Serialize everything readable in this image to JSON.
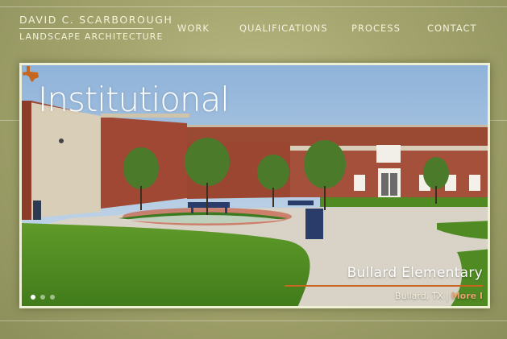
{
  "brand": {
    "name": "DAVID C. SCARBOROUGH",
    "tagline": "LANDSCAPE ARCHITECTURE"
  },
  "nav": {
    "items": [
      {
        "label": "WORK"
      },
      {
        "label": "QUALIFICATIONS"
      },
      {
        "label": "PROCESS"
      },
      {
        "label": "CONTACT"
      }
    ]
  },
  "hero": {
    "category": "Institutional",
    "category_icon": "texas-state-icon",
    "project_title": "Bullard Elementary",
    "location": "Bullard, TX",
    "separator": "|",
    "more_link": "More I",
    "slides_total": 3,
    "slide_active": 1
  },
  "colors": {
    "background": "#a4a56e",
    "text": "#f4f2dc",
    "accent": "#c7661f",
    "frame": "#eff1d7"
  }
}
